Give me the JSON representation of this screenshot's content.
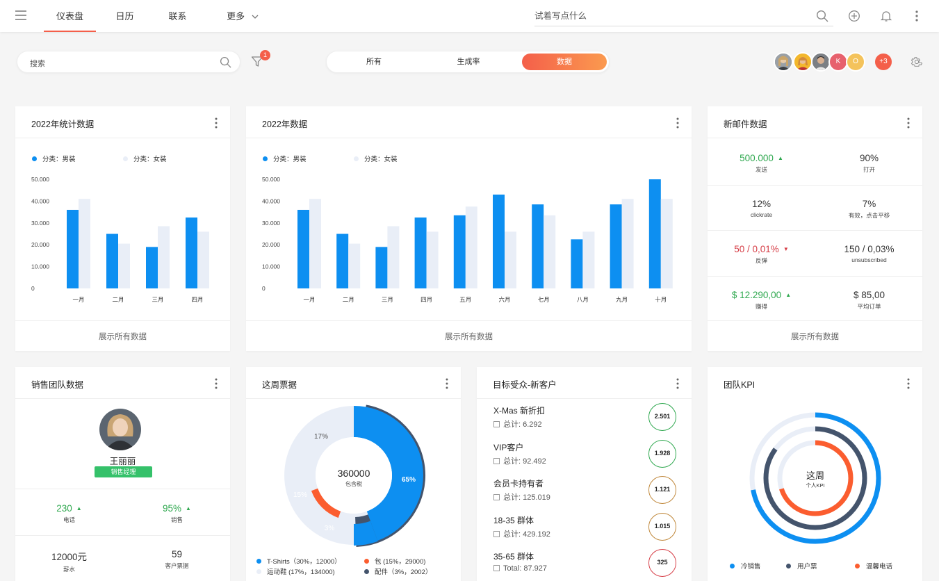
{
  "nav": {
    "items": [
      "仪表盘",
      "日历",
      "联系",
      "更多"
    ],
    "search_placeholder": "试着写点什么"
  },
  "toolbar": {
    "search_placeholder": "搜索",
    "filter_badge": "1",
    "segments": [
      "所有",
      "生成率",
      "数据"
    ],
    "active_segment": "数据",
    "avatars": [
      "K",
      "O",
      "+3"
    ]
  },
  "colors": {
    "accent": "#f45f4a",
    "blue": "#0d8ff1",
    "light_bar": "#e9eef7",
    "green": "#2fa84f",
    "red": "#d63d46",
    "navy": "#44546c",
    "orange": "#fb5d2f"
  },
  "stats2022": {
    "title": "2022年统计数据",
    "legend": [
      "分类：男装",
      "分类：女装"
    ],
    "yticks": [
      "50.000",
      "40.000",
      "30.000",
      "20.000",
      "10.000",
      "0"
    ],
    "footer": "展示所有数据"
  },
  "data2022": {
    "title": "2022年数据",
    "legend": [
      "分类：男装",
      "分类：女装"
    ],
    "yticks": [
      "50.000",
      "40.000",
      "30.000",
      "20.000",
      "10.000",
      "0"
    ],
    "footer": "展示所有数据"
  },
  "chart_data": [
    {
      "type": "bar",
      "title": "2022年统计数据",
      "categories": [
        "一月",
        "二月",
        "三月",
        "四月"
      ],
      "series": [
        {
          "name": "分类：男装",
          "values": [
            36000,
            25000,
            19000,
            32500
          ]
        },
        {
          "name": "分类：女装",
          "values": [
            41000,
            20500,
            28500,
            26000
          ]
        }
      ],
      "ylim": [
        0,
        50000
      ],
      "yticks": [
        "50.000",
        "40.000",
        "30.000",
        "20.000",
        "10.000",
        "0"
      ],
      "grid": false,
      "legend": "top-left"
    },
    {
      "type": "bar",
      "title": "2022年数据",
      "categories": [
        "一月",
        "二月",
        "三月",
        "四月",
        "五月",
        "六月",
        "七月",
        "八月",
        "九月",
        "十月"
      ],
      "series": [
        {
          "name": "分类：男装",
          "values": [
            36000,
            25000,
            19000,
            32500,
            33500,
            43000,
            38500,
            22500,
            38500,
            50000
          ]
        },
        {
          "name": "分类：女装",
          "values": [
            41000,
            20500,
            28500,
            26000,
            37500,
            26000,
            33500,
            26000,
            41000,
            41000
          ]
        }
      ],
      "ylim": [
        0,
        50000
      ],
      "yticks": [
        "50.000",
        "40.000",
        "30.000",
        "20.000",
        "10.000",
        "0"
      ],
      "grid": false,
      "legend": "top-left"
    },
    {
      "type": "pie",
      "title": "这周票据",
      "center_value": "360000",
      "center_label": "包含税",
      "slices": [
        {
          "label": "T-Shirts",
          "percent": 65,
          "text": "T-Shirts（30%，12000）"
        },
        {
          "label": "配件",
          "percent": 3,
          "text": "配件（3%，2002）"
        },
        {
          "label": "包",
          "percent": 15,
          "text": "包 (15%，29000)"
        },
        {
          "label": "运动鞋",
          "percent": 17,
          "text": "运动鞋 (17%，134000)"
        }
      ],
      "slice_labels": [
        "65%",
        "17%",
        "15%",
        "3%"
      ]
    },
    {
      "type": "pie",
      "title": "团队KPI",
      "center_value": "这周",
      "center_label": "个人KPI",
      "rings": [
        {
          "name": "冷销售",
          "value": 0.72
        },
        {
          "name": "用户票",
          "value": 0.85
        },
        {
          "name": "温馨电话",
          "value": 0.7
        }
      ]
    }
  ],
  "mail": {
    "title": "新邮件数据",
    "cells": [
      {
        "value": "500.000",
        "label": "发送",
        "trend": "up"
      },
      {
        "value": "90%",
        "label": "打开"
      },
      {
        "value": "12%",
        "label": "clickrate"
      },
      {
        "value": "7%",
        "label": "有效，点击平移"
      },
      {
        "value": "50 / 0,01%",
        "label": "反弹",
        "trend": "down"
      },
      {
        "value": "150 / 0,03%",
        "label": "unsubscribed"
      },
      {
        "value": "$ 12.290,00",
        "label": "赚得",
        "trend": "up"
      },
      {
        "value": "$ 85,00",
        "label": "平均订单"
      }
    ],
    "footer": "展示所有数据"
  },
  "sales": {
    "title": "销售团队数据",
    "name": "王丽丽",
    "role": "销售经理",
    "stats": [
      {
        "value": "230",
        "label": "电话",
        "trend": "up"
      },
      {
        "value": "95%",
        "label": "销售",
        "trend": "up"
      },
      {
        "value": "12000元",
        "label": "薪水"
      },
      {
        "value": "59",
        "label": "客户票据"
      }
    ]
  },
  "tickets": {
    "title": "这周票据",
    "center_value": "360000",
    "center_label": "包含税",
    "labels": [
      "65%",
      "17%",
      "15%",
      "3%"
    ],
    "legend": [
      "T-Shirts（30%，12000）",
      "包 (15%，29000)",
      "运动鞋 (17%，134000)",
      "配件（3%，2002）"
    ]
  },
  "target": {
    "title": "目标受众-新客户",
    "items": [
      {
        "name": "X-Mas 新折扣",
        "total": "总计: 6.292",
        "score": "2.501",
        "color": "#2fa84f"
      },
      {
        "name": "VIP客户",
        "total": "总计: 92.492",
        "score": "1.928",
        "color": "#2fa84f"
      },
      {
        "name": "会员卡持有者",
        "total": "总计: 125.019",
        "score": "1.121",
        "color": "#c0883b"
      },
      {
        "name": "18-35 群体",
        "total": "总计: 429.192",
        "score": "1.015",
        "color": "#c0883b"
      },
      {
        "name": "35-65 群体",
        "total": "Total: 87.927",
        "score": "325",
        "color": "#d63d46"
      }
    ]
  },
  "kpi": {
    "title": "团队KPI",
    "center_value": "这周",
    "center_label": "个人KPI",
    "legend": [
      "冷销售",
      "用户票",
      "温馨电话"
    ]
  }
}
